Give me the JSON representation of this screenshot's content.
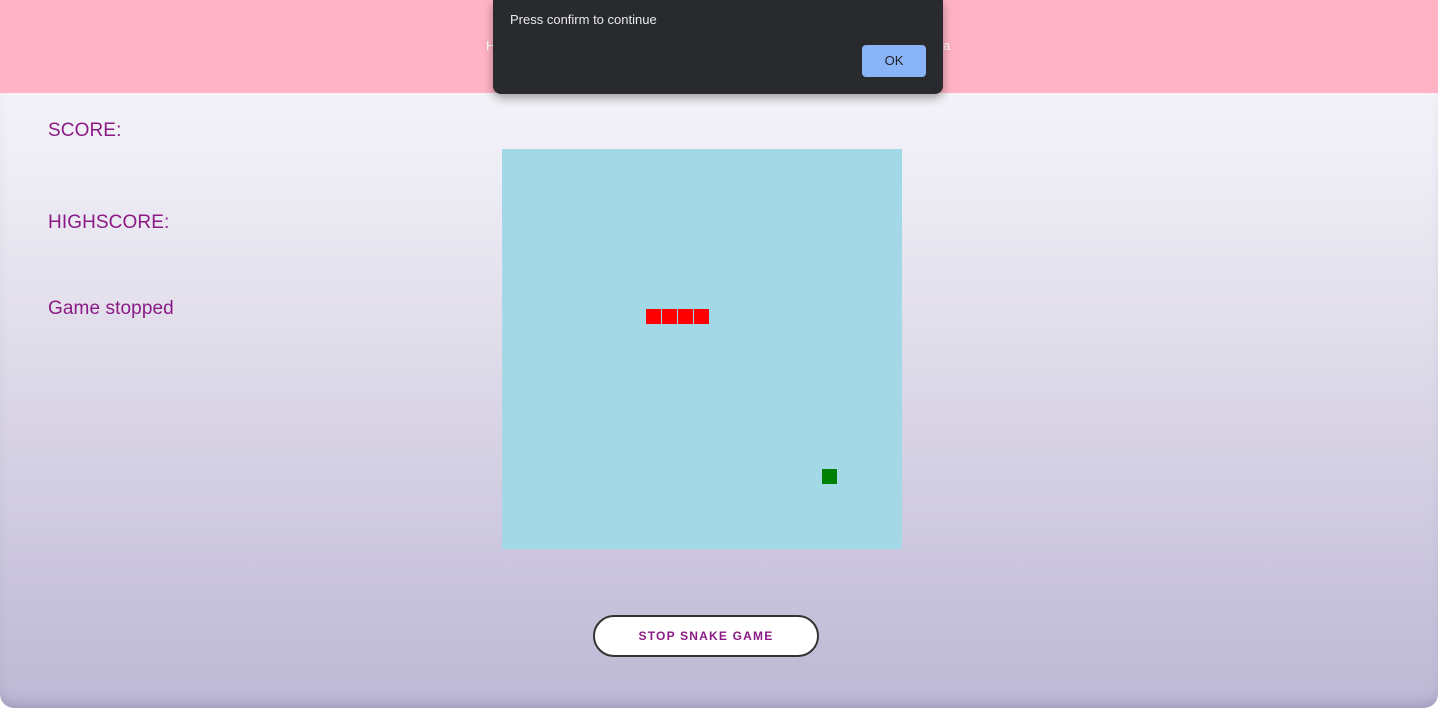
{
  "header": {
    "hint_left": "H",
    "hint_right": "a",
    "background": "#ffb3c4"
  },
  "sidebar": {
    "score_label": "SCORE:",
    "highscore_label": "HIGHSCORE:",
    "status": "Game stopped",
    "text_color": "#8b1a86"
  },
  "board": {
    "background": "#a3d9e7",
    "snake_color": "#ff0000",
    "food_color": "#008000",
    "snake_segments": 4
  },
  "controls": {
    "stop_button_label": "STOP SNAKE GAME"
  },
  "dialog": {
    "message": "Press confirm to continue",
    "ok_label": "OK",
    "ok_color": "#8ab4f8"
  }
}
